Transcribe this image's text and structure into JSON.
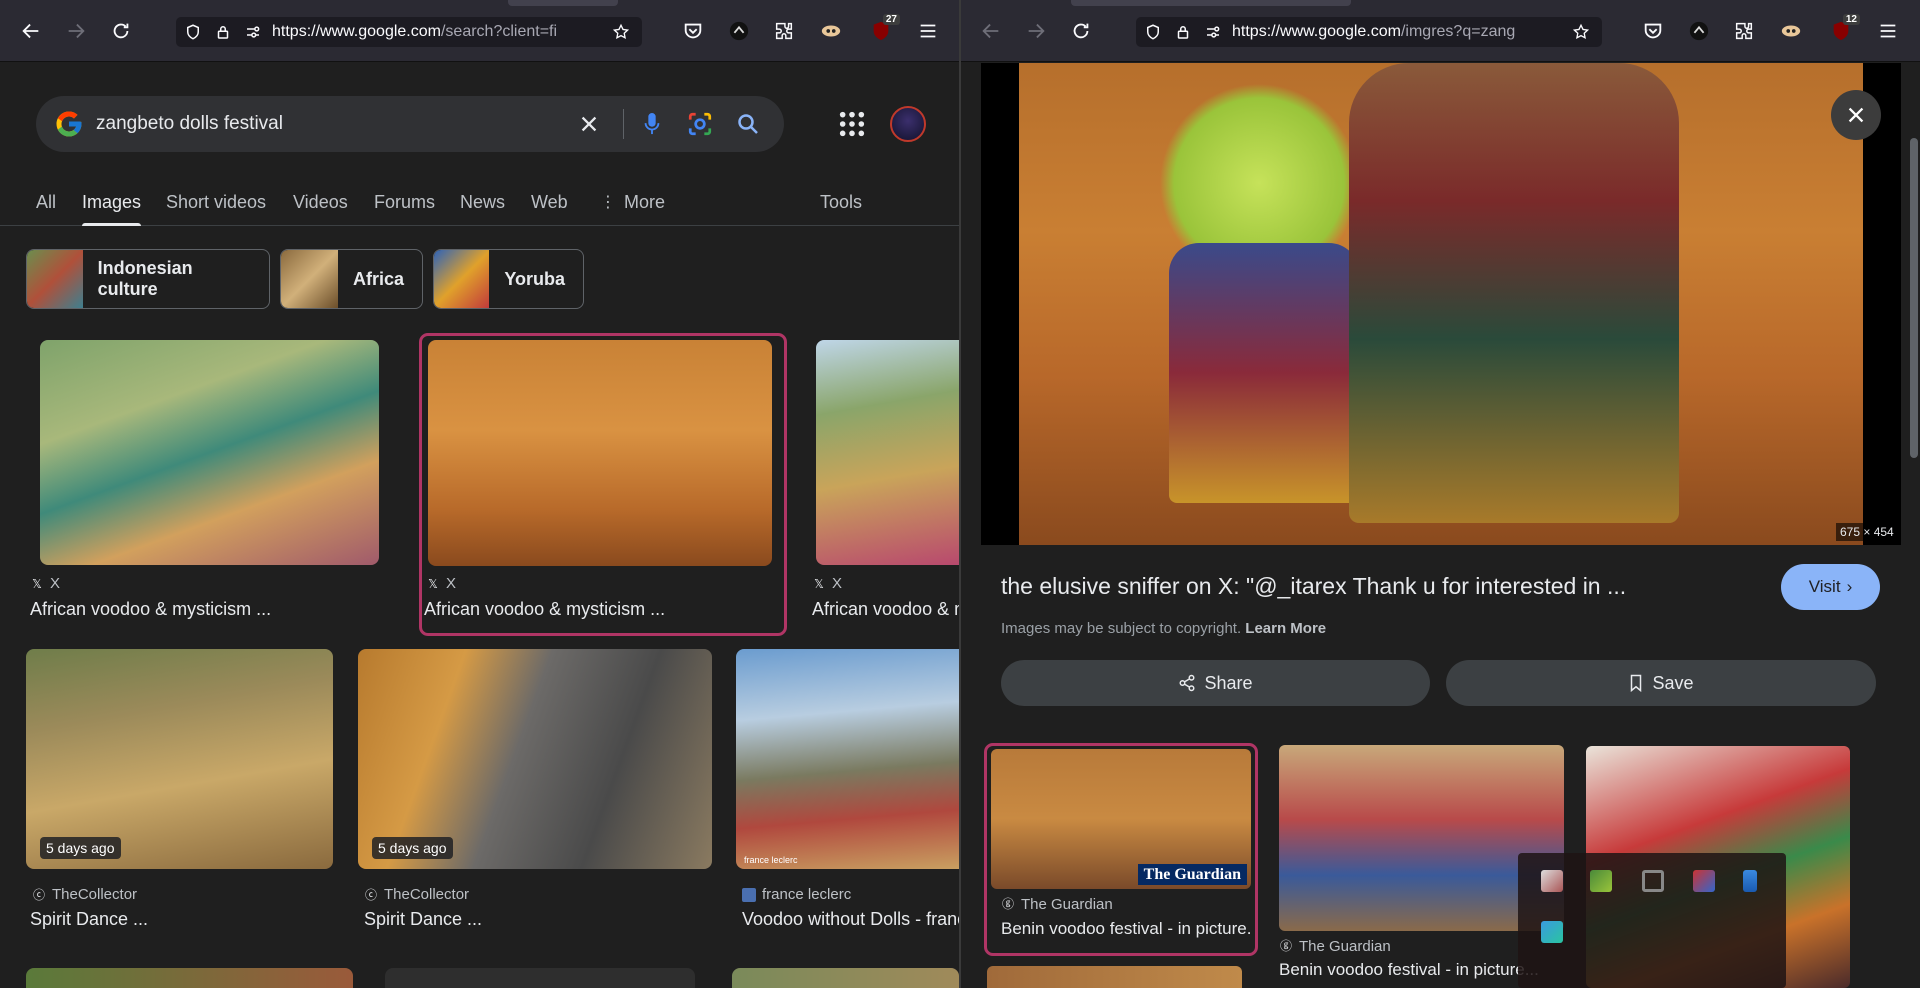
{
  "left": {
    "url_main": "https://www.google.com",
    "url_rest": "/search?client=fi",
    "badge": "27",
    "search": {
      "query": "zangbeto dolls festival"
    },
    "tabs": [
      "All",
      "Images",
      "Short videos",
      "Videos",
      "Forums",
      "News",
      "Web",
      "More",
      "Tools"
    ],
    "active_tab": "Images",
    "chips": [
      {
        "label": "Indonesian culture"
      },
      {
        "label": "Africa"
      },
      {
        "label": "Yoruba"
      }
    ],
    "row1": [
      {
        "source": "X",
        "title": "African voodoo & mysticism ..."
      },
      {
        "source": "X",
        "title": "African voodoo & mysticism ..."
      },
      {
        "source": "X",
        "title": "African voodoo & m"
      }
    ],
    "row2": [
      {
        "badge": "5 days ago",
        "source": "TheCollector",
        "title": "Spirit Dance ..."
      },
      {
        "badge": "5 days ago",
        "source": "TheCollector",
        "title": "Spirit Dance ..."
      },
      {
        "source": "france leclerc",
        "title": "Voodoo without Dolls - franc",
        "watermark": "france leclerc"
      }
    ]
  },
  "right": {
    "url_main": "https://www.google.com",
    "url_rest": "/imgres?q=zang",
    "badge": "12",
    "preview": {
      "dims": "675 × 454",
      "title": "the elusive sniffer on X: \"@_itarex Thank u for interested in ...",
      "visit_label": "Visit",
      "copyright": "Images may be subject to copyright.",
      "learn_more": "Learn More",
      "share_label": "Share",
      "save_label": "Save"
    },
    "related": [
      {
        "source": "The Guardian",
        "title": "Benin voodoo festival - in picture...",
        "logo": "The Guardian"
      },
      {
        "source": "The Guardian",
        "title": "Benin voodoo festival - in picture..."
      }
    ]
  },
  "colors": {
    "accent": "#8ab4f8",
    "selection": "#b03565",
    "background": "#1f1f1f",
    "toolbar": "#2b2a33"
  }
}
